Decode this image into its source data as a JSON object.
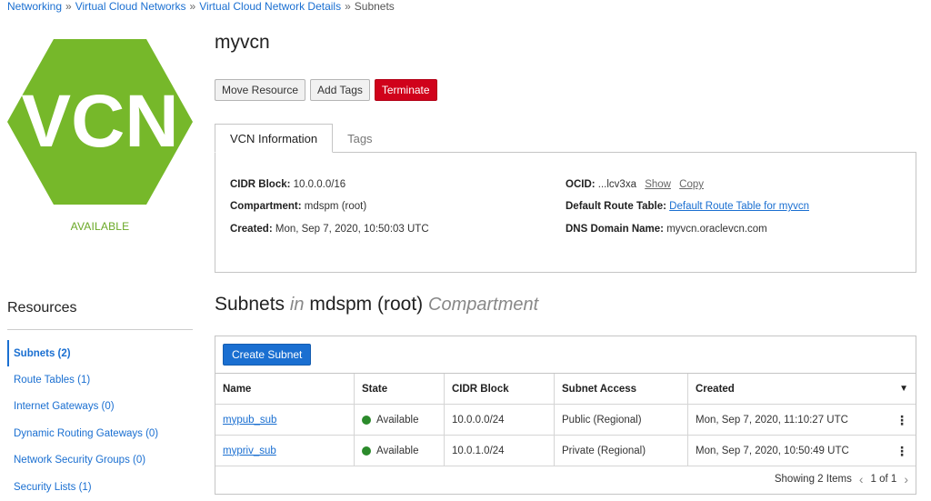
{
  "breadcrumb": {
    "items": [
      "Networking",
      "Virtual Cloud Networks",
      "Virtual Cloud Network Details"
    ],
    "current": "Subnets",
    "separator": "»"
  },
  "vcn": {
    "badge_text": "VCN",
    "badge_color": "#76b82a",
    "status": "AVAILABLE",
    "name": "myvcn"
  },
  "actions": {
    "move": "Move Resource",
    "add_tags": "Add Tags",
    "terminate": "Terminate"
  },
  "tabs": {
    "info": "VCN Information",
    "tags": "Tags"
  },
  "info": {
    "cidr_label": "CIDR Block:",
    "cidr_value": "10.0.0.0/16",
    "compartment_label": "Compartment:",
    "compartment_value": "mdspm (root)",
    "created_label": "Created:",
    "created_value": "Mon, Sep 7, 2020, 10:50:03 UTC",
    "ocid_label": "OCID:",
    "ocid_value": "...lcv3xa",
    "ocid_show": "Show",
    "ocid_copy": "Copy",
    "route_label": "Default Route Table:",
    "route_value": "Default Route Table for myvcn",
    "dns_label": "DNS Domain Name:",
    "dns_value": "myvcn.oraclevcn.com"
  },
  "resources": {
    "title": "Resources",
    "items": [
      "Subnets (2)",
      "Route Tables (1)",
      "Internet Gateways (0)",
      "Dynamic Routing Gateways (0)",
      "Network Security Groups (0)",
      "Security Lists (1)"
    ]
  },
  "subnets": {
    "title_main": "Subnets",
    "title_in": "in",
    "title_compartment": "mdspm (root)",
    "title_suffix": "Compartment",
    "create_button": "Create Subnet",
    "columns": [
      "Name",
      "State",
      "CIDR Block",
      "Subnet Access",
      "Created"
    ],
    "rows": [
      {
        "name": "mypub_sub",
        "state": "Available",
        "cidr": "10.0.0.0/24",
        "access": "Public (Regional)",
        "created": "Mon, Sep 7, 2020, 11:10:27 UTC"
      },
      {
        "name": "mypriv_sub",
        "state": "Available",
        "cidr": "10.0.1.0/24",
        "access": "Private (Regional)",
        "created": "Mon, Sep 7, 2020, 10:50:49 UTC"
      }
    ],
    "showing": "Showing 2 Items",
    "page": "1 of 1",
    "status_color": "#2b8a2b"
  }
}
